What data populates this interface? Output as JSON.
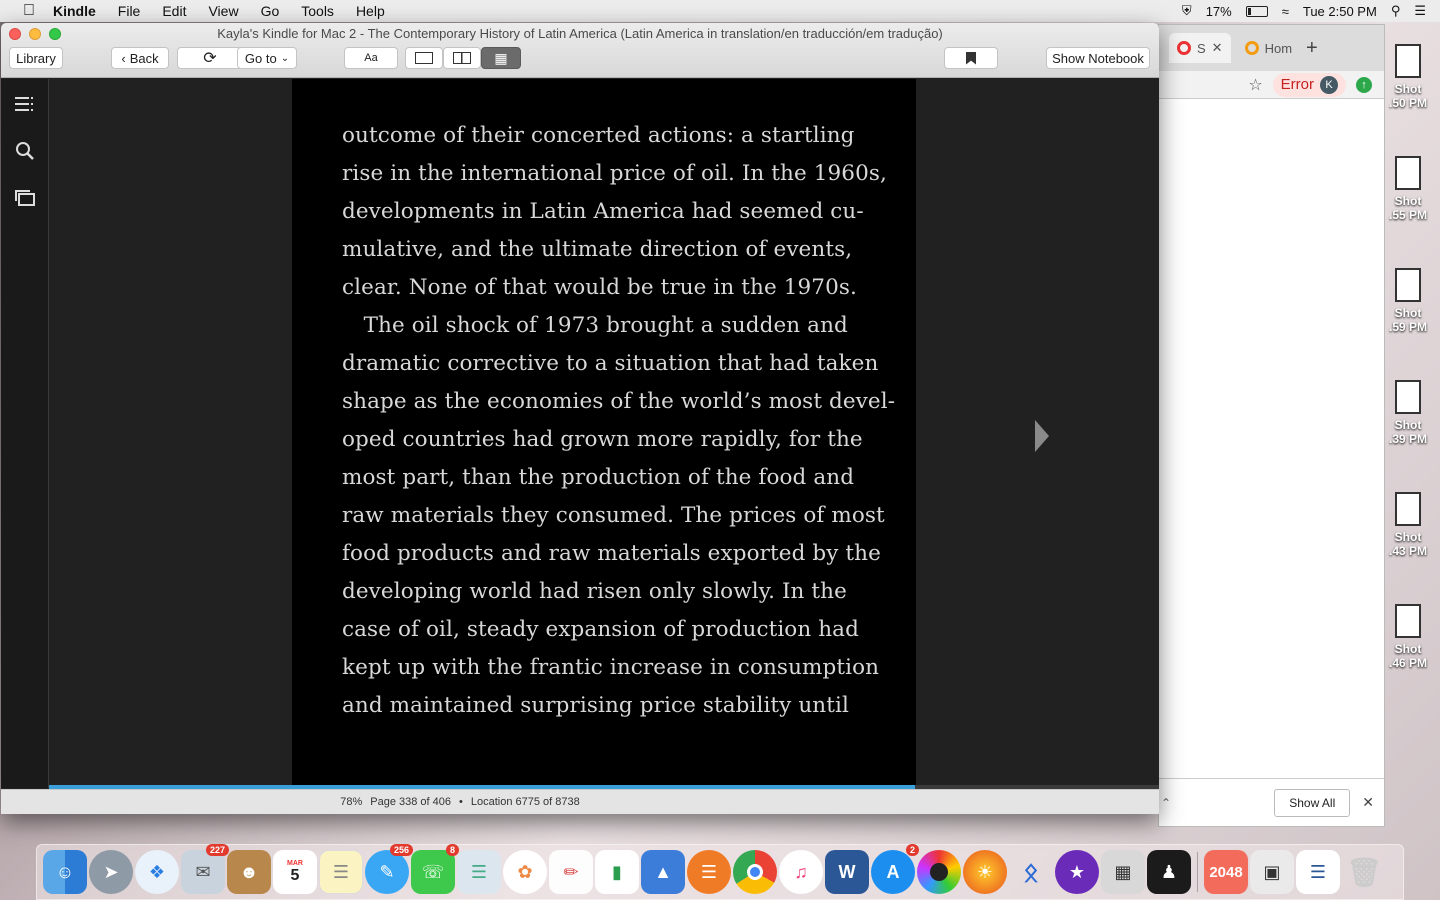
{
  "menubar": {
    "app": "Kindle",
    "menus": [
      "File",
      "Edit",
      "View",
      "Go",
      "Tools",
      "Help"
    ],
    "battery": "17%",
    "clock": "Tue 2:50 PM"
  },
  "desktop": {
    "shots": [
      {
        "label1": "Shot",
        "label2": ".50 PM"
      },
      {
        "label1": "Shot",
        "label2": ".55 PM"
      },
      {
        "label1": "Shot",
        "label2": ".59 PM"
      },
      {
        "label1": "Shot",
        "label2": ".39 PM"
      },
      {
        "label1": "Shot",
        "label2": ".43 PM"
      },
      {
        "label1": "Shot",
        "label2": ".46 PM"
      }
    ]
  },
  "kindle": {
    "title": "Kayla's Kindle for Mac 2 - The Contemporary History of Latin America (Latin America in translation/en traducción/em tradução)",
    "toolbar": {
      "library": "Library",
      "back": "Back",
      "goto": "Go to",
      "font": "Aa",
      "show_notebook": "Show Notebook"
    },
    "text_lines": [
      "outcome of their concerted actions: a startling",
      "rise in the international price of oil. In the 1960s,",
      "developments in Latin America had seemed cu-",
      "mulative, and the ultimate direction of events,",
      "clear. None of that would be true in the 1970s.",
      " The oil shock of 1973 brought a sudden and",
      "dramatic corrective to a situation that had taken",
      "shape as the economies of the world’s most devel-",
      "oped countries had grown more rapidly, for the",
      "most part, than the production of the food and",
      "raw materials they consumed. The prices of most",
      "food products and raw materials exported by the",
      "developing world had risen only slowly. In the",
      "case of oil, steady expansion of production had",
      "kept up with the frantic increase in consumption",
      "and maintained surprising price stability until"
    ],
    "status": {
      "percent": "78%",
      "page": "Page 338 of 406",
      "separator": "•",
      "location": "Location 6775 of 8738"
    },
    "progress_fraction": 0.78
  },
  "browser": {
    "tab1_label": "S",
    "tab2_label": "Hom",
    "new_tab": "+",
    "error_label": "Error",
    "avatar_letter": "K",
    "show_all": "Show All",
    "close": "✕"
  },
  "dock": {
    "badges": {
      "mail": "227",
      "messages": "256",
      "facetime": "8",
      "appstore": "2"
    },
    "calendar_month": "MAR",
    "calendar_day": "5",
    "game_label": "2048"
  }
}
